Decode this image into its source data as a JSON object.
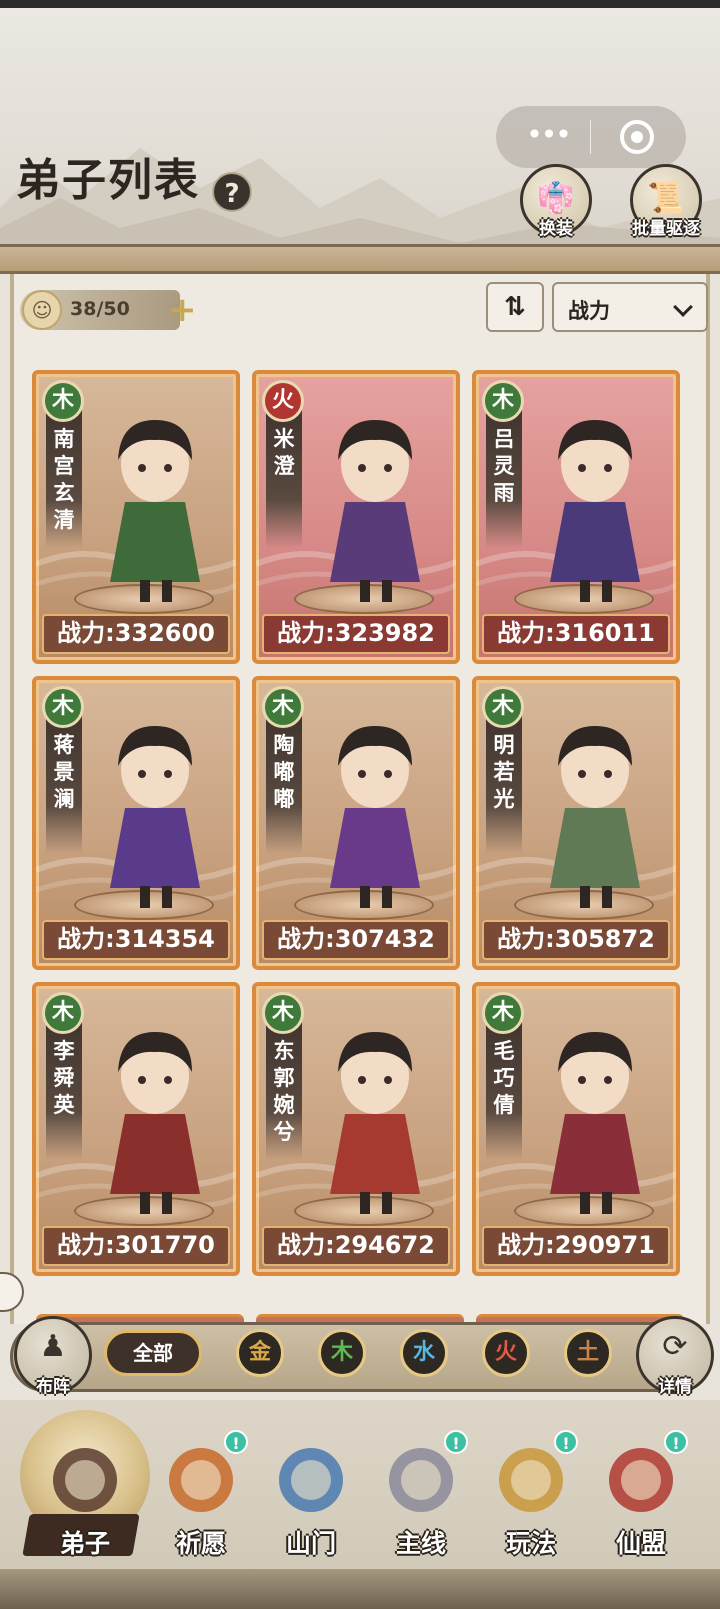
{
  "header": {
    "title": "弟子列表",
    "help_label": "?",
    "capsule": {
      "more_label": "•••"
    },
    "buttons": [
      {
        "label": "换装",
        "icon": "outfit-icon"
      },
      {
        "label": "批量驱逐",
        "icon": "scroll-icon"
      }
    ]
  },
  "toolbar": {
    "count": "38/50",
    "plus_label": "+",
    "sort_icon_label": "⇅",
    "sort_value": "战力"
  },
  "disciples": [
    {
      "name": "南宫玄清",
      "element": "木",
      "element_type": "wood",
      "power_text": "战力:332600",
      "power": 332600,
      "robe_color": "#3f6b3a"
    },
    {
      "name": "米澄",
      "element": "火",
      "element_type": "fire",
      "power_text": "战力:323982",
      "power": 323982,
      "robe_color": "#5a3b7a"
    },
    {
      "name": "吕灵雨",
      "element": "木",
      "element_type": "fire",
      "power_text": "战力:316011",
      "power": 316011,
      "robe_color": "#4a3a7a"
    },
    {
      "name": "蒋景澜",
      "element": "木",
      "element_type": "wood",
      "power_text": "战力:314354",
      "power": 314354,
      "robe_color": "#5a3a8a"
    },
    {
      "name": "陶嘟嘟",
      "element": "木",
      "element_type": "wood",
      "power_text": "战力:307432",
      "power": 307432,
      "robe_color": "#6a3a8a"
    },
    {
      "name": "明若光",
      "element": "木",
      "element_type": "wood",
      "power_text": "战力:305872",
      "power": 305872,
      "robe_color": "#5f7a55"
    },
    {
      "name": "李舜英",
      "element": "木",
      "element_type": "wood",
      "power_text": "战力:301770",
      "power": 301770,
      "robe_color": "#8a2f2c"
    },
    {
      "name": "东郭婉兮",
      "element": "木",
      "element_type": "wood",
      "power_text": "战力:294672",
      "power": 294672,
      "robe_color": "#a63a30"
    },
    {
      "name": "毛巧倩",
      "element": "木",
      "element_type": "wood",
      "power_text": "战力:290971",
      "power": 290971,
      "robe_color": "#8a2f3a"
    }
  ],
  "filter": {
    "formation_label": "布阵",
    "all_label": "全部",
    "elements": [
      {
        "label": "金",
        "color": "#d8a84a"
      },
      {
        "label": "木",
        "color": "#5dbb53"
      },
      {
        "label": "水",
        "color": "#56b7e0"
      },
      {
        "label": "火",
        "color": "#e05a48"
      },
      {
        "label": "土",
        "color": "#c6844a"
      }
    ],
    "details_label": "详情"
  },
  "nav": [
    {
      "label": "弟子",
      "active": true,
      "badge": ""
    },
    {
      "label": "祈愿",
      "active": false,
      "badge": "!"
    },
    {
      "label": "山门",
      "active": false,
      "badge": ""
    },
    {
      "label": "主线",
      "active": false,
      "badge": "!"
    },
    {
      "label": "玩法",
      "active": false,
      "badge": "!"
    },
    {
      "label": "仙盟",
      "active": false,
      "badge": "!"
    }
  ]
}
